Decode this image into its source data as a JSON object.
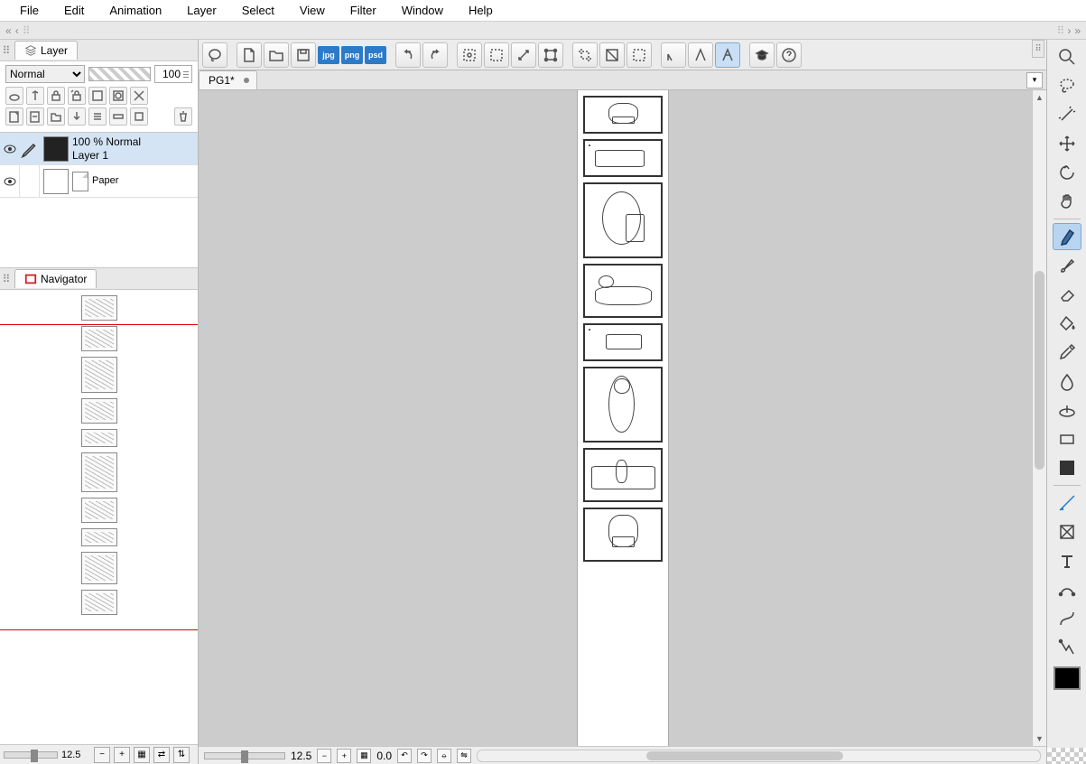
{
  "menu": {
    "items": [
      "File",
      "Edit",
      "Animation",
      "Layer",
      "Select",
      "View",
      "Filter",
      "Window",
      "Help"
    ]
  },
  "layerPanel": {
    "tabLabel": "Layer",
    "blendMode": "Normal",
    "opacity": "100",
    "layers": [
      {
        "opacityLabel": "100 % Normal",
        "name": "Layer 1",
        "selected": true,
        "thumb": "dark"
      },
      {
        "opacityLabel": "",
        "name": "Paper",
        "selected": false,
        "thumb": "paper"
      }
    ]
  },
  "navigator": {
    "tabLabel": "Navigator",
    "zoom": "12.5"
  },
  "document": {
    "tabLabel": "PG1*"
  },
  "statusBar": {
    "zoom": "12.5",
    "rotation": "0.0"
  },
  "toolbar": {
    "fileFormats": [
      "jpg",
      "png",
      "psd"
    ]
  }
}
